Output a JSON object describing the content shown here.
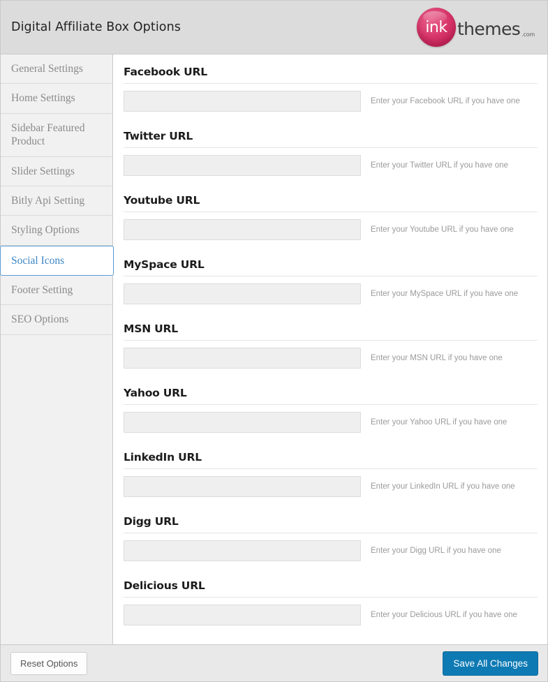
{
  "header": {
    "title": "Digital Affiliate Box Options",
    "logo": {
      "mark_text": "ink",
      "word": "themes",
      "tld": ".com",
      "mark_color": "#d9376b",
      "word_color": "#3a3a3a"
    }
  },
  "sidebar": {
    "items": [
      {
        "label": "General Settings",
        "active": false
      },
      {
        "label": "Home Settings",
        "active": false
      },
      {
        "label": "Sidebar Featured Product",
        "active": false
      },
      {
        "label": "Slider Settings",
        "active": false
      },
      {
        "label": "Bitly Api Setting",
        "active": false
      },
      {
        "label": "Styling Options",
        "active": false
      },
      {
        "label": "Social Icons",
        "active": true
      },
      {
        "label": "Footer Setting",
        "active": false
      },
      {
        "label": "SEO Options",
        "active": false
      }
    ],
    "active_color": "#3d86c6",
    "background": "#f1f1f1"
  },
  "main": {
    "fields": [
      {
        "title": "Facebook URL",
        "value": "",
        "placeholder": "",
        "description": "Enter your Facebook URL if you have one"
      },
      {
        "title": "Twitter URL",
        "value": "",
        "placeholder": "",
        "description": "Enter your Twitter URL if you have one"
      },
      {
        "title": "Youtube URL",
        "value": "",
        "placeholder": "",
        "description": "Enter your Youtube URL if you have one"
      },
      {
        "title": "MySpace URL",
        "value": "",
        "placeholder": "",
        "description": "Enter your MySpace URL if you have one"
      },
      {
        "title": "MSN URL",
        "value": "",
        "placeholder": "",
        "description": "Enter your MSN URL if you have one"
      },
      {
        "title": "Yahoo URL",
        "value": "",
        "placeholder": "",
        "description": "Enter your Yahoo URL if you have one"
      },
      {
        "title": "LinkedIn URL",
        "value": "",
        "placeholder": "",
        "description": "Enter your LinkedIn URL if you have one"
      },
      {
        "title": "Digg URL",
        "value": "",
        "placeholder": "",
        "description": "Enter your Digg URL if you have one"
      },
      {
        "title": "Delicious URL",
        "value": "",
        "placeholder": "",
        "description": "Enter your Delicious URL if you have one"
      }
    ]
  },
  "footer": {
    "reset_label": "Reset Options",
    "save_label": "Save All Changes",
    "save_color": "#0e7ab4"
  }
}
